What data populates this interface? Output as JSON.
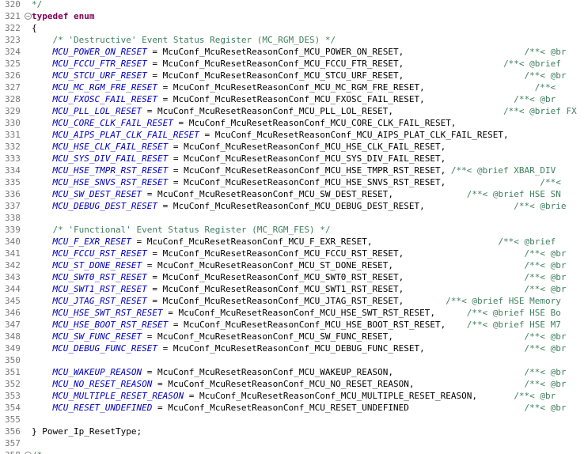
{
  "editor": {
    "lines": [
      {
        "n": "320",
        "fold": false,
        "segs": [
          {
            "c": "cm",
            "t": "*/"
          }
        ]
      },
      {
        "n": "321",
        "fold": true,
        "segs": [
          {
            "c": "kw",
            "t": "typedef enum"
          }
        ]
      },
      {
        "n": "322",
        "fold": false,
        "segs": [
          {
            "c": "tx",
            "t": "{"
          }
        ]
      },
      {
        "n": "323",
        "fold": false,
        "segs": [
          {
            "c": "tx",
            "t": "    "
          },
          {
            "c": "cm",
            "t": "/* 'Destructive' Event Status Register (MC_RGM_DES) */"
          }
        ]
      },
      {
        "n": "324",
        "fold": false,
        "segs": [
          {
            "c": "tx",
            "t": "    "
          },
          {
            "c": "en",
            "t": "MCU_POWER_ON_RESET"
          },
          {
            "c": "tx",
            "t": " = McuConf_McuResetReasonConf_MCU_POWER_ON_RESET,                       "
          },
          {
            "c": "cm",
            "t": "/**< @br"
          }
        ]
      },
      {
        "n": "325",
        "fold": false,
        "segs": [
          {
            "c": "tx",
            "t": "    "
          },
          {
            "c": "en",
            "t": "MCU_FCCU_FTR_RESET"
          },
          {
            "c": "tx",
            "t": " = McuConf_McuResetReasonConf_MCU_FCCU_FTR_RESET,                   "
          },
          {
            "c": "cm",
            "t": "/**< @brief"
          }
        ]
      },
      {
        "n": "326",
        "fold": false,
        "segs": [
          {
            "c": "tx",
            "t": "    "
          },
          {
            "c": "en",
            "t": "MCU_STCU_URF_RESET"
          },
          {
            "c": "tx",
            "t": " = McuConf_McuResetReasonConf_MCU_STCU_URF_RESET,                       "
          },
          {
            "c": "cm",
            "t": "/**< @br"
          }
        ]
      },
      {
        "n": "327",
        "fold": false,
        "segs": [
          {
            "c": "tx",
            "t": "    "
          },
          {
            "c": "en",
            "t": "MCU_MC_RGM_FRE_RESET"
          },
          {
            "c": "tx",
            "t": " = McuConf_McuResetReasonConf_MCU_MC_RGM_FRE_RESET,                     "
          },
          {
            "c": "cm",
            "t": "/**<"
          }
        ]
      },
      {
        "n": "328",
        "fold": false,
        "segs": [
          {
            "c": "tx",
            "t": "    "
          },
          {
            "c": "en",
            "t": "MCU_FXOSC_FAIL_RESET"
          },
          {
            "c": "tx",
            "t": " = McuConf_McuResetReasonConf_MCU_FXOSC_FAIL_RESET,                 "
          },
          {
            "c": "cm",
            "t": "/**< @br"
          }
        ]
      },
      {
        "n": "329",
        "fold": false,
        "segs": [
          {
            "c": "tx",
            "t": "    "
          },
          {
            "c": "en",
            "t": "MCU_PLL_LOL_RESET"
          },
          {
            "c": "tx",
            "t": " = McuConf_McuResetReasonConf_MCU_PLL_LOL_RESET,                     "
          },
          {
            "c": "cm",
            "t": "/**< @brief FX"
          }
        ]
      },
      {
        "n": "330",
        "fold": false,
        "segs": [
          {
            "c": "tx",
            "t": "    "
          },
          {
            "c": "en",
            "t": "MCU_CORE_CLK_FAIL_RESET"
          },
          {
            "c": "tx",
            "t": " = McuConf_McuResetReasonConf_MCU_CORE_CLK_FAIL_RESET,"
          }
        ]
      },
      {
        "n": "331",
        "fold": false,
        "segs": [
          {
            "c": "tx",
            "t": "    "
          },
          {
            "c": "en",
            "t": "MCU_AIPS_PLAT_CLK_FAIL_RESET"
          },
          {
            "c": "tx",
            "t": " = McuConf_McuResetReasonConf_MCU_AIPS_PLAT_CLK_FAIL_RESET,"
          }
        ]
      },
      {
        "n": "332",
        "fold": false,
        "segs": [
          {
            "c": "tx",
            "t": "    "
          },
          {
            "c": "en",
            "t": "MCU_HSE_CLK_FAIL_RESET"
          },
          {
            "c": "tx",
            "t": " = McuConf_McuResetReasonConf_MCU_HSE_CLK_FAIL_RESET,"
          }
        ]
      },
      {
        "n": "333",
        "fold": false,
        "segs": [
          {
            "c": "tx",
            "t": "    "
          },
          {
            "c": "en",
            "t": "MCU_SYS_DIV_FAIL_RESET"
          },
          {
            "c": "tx",
            "t": " = McuConf_McuResetReasonConf_MCU_SYS_DIV_FAIL_RESET,"
          }
        ]
      },
      {
        "n": "334",
        "fold": false,
        "segs": [
          {
            "c": "tx",
            "t": "    "
          },
          {
            "c": "en",
            "t": "MCU_HSE_TMPR_RST_RESET"
          },
          {
            "c": "tx",
            "t": " = McuConf_McuResetReasonConf_MCU_HSE_TMPR_RST_RESET, "
          },
          {
            "c": "cm",
            "t": "/**< @brief XBAR_DIV"
          }
        ]
      },
      {
        "n": "335",
        "fold": false,
        "segs": [
          {
            "c": "tx",
            "t": "    "
          },
          {
            "c": "en",
            "t": "MCU_HSE_SNVS_RST_RESET"
          },
          {
            "c": "tx",
            "t": " = McuConf_McuResetReasonConf_MCU_HSE_SNVS_RST_RESET,                  "
          },
          {
            "c": "cm",
            "t": "/**<"
          }
        ]
      },
      {
        "n": "336",
        "fold": false,
        "segs": [
          {
            "c": "tx",
            "t": "    "
          },
          {
            "c": "en",
            "t": "MCU_SW_DEST_RESET"
          },
          {
            "c": "tx",
            "t": " = McuConf_McuResetReasonConf_MCU_SW_DEST_RESET,              "
          },
          {
            "c": "cm",
            "t": "/**< @brief HSE SN"
          }
        ]
      },
      {
        "n": "337",
        "fold": false,
        "segs": [
          {
            "c": "tx",
            "t": "    "
          },
          {
            "c": "en",
            "t": "MCU_DEBUG_DEST_RESET"
          },
          {
            "c": "tx",
            "t": " = McuConf_McuResetReasonConf_MCU_DEBUG_DEST_RESET,                 "
          },
          {
            "c": "cm",
            "t": "/**< @brie"
          }
        ]
      },
      {
        "n": "338",
        "fold": false,
        "segs": []
      },
      {
        "n": "339",
        "fold": false,
        "segs": [
          {
            "c": "tx",
            "t": "    "
          },
          {
            "c": "cm",
            "t": "/* 'Functional' Event Status Register (MC_RGM_FES) */"
          }
        ]
      },
      {
        "n": "340",
        "fold": false,
        "segs": [
          {
            "c": "tx",
            "t": "    "
          },
          {
            "c": "en",
            "t": "MCU_F_EXR_RESET"
          },
          {
            "c": "tx",
            "t": " = McuConf_McuResetReasonConf_MCU_F_EXR_RESET,                        "
          },
          {
            "c": "cm",
            "t": "/**< @brief"
          }
        ]
      },
      {
        "n": "341",
        "fold": false,
        "segs": [
          {
            "c": "tx",
            "t": "    "
          },
          {
            "c": "en",
            "t": "MCU_FCCU_RST_RESET"
          },
          {
            "c": "tx",
            "t": " = McuConf_McuResetReasonConf_MCU_FCCU_RST_RESET,                       "
          },
          {
            "c": "cm",
            "t": "/**< @br"
          }
        ]
      },
      {
        "n": "342",
        "fold": false,
        "segs": [
          {
            "c": "tx",
            "t": "    "
          },
          {
            "c": "en",
            "t": "MCU_ST_DONE_RESET"
          },
          {
            "c": "tx",
            "t": " = McuConf_McuResetReasonConf_MCU_ST_DONE_RESET,                         "
          },
          {
            "c": "cm",
            "t": "/**< @br"
          }
        ]
      },
      {
        "n": "343",
        "fold": false,
        "segs": [
          {
            "c": "tx",
            "t": "    "
          },
          {
            "c": "en",
            "t": "MCU_SWT0_RST_RESET"
          },
          {
            "c": "tx",
            "t": " = McuConf_McuResetReasonConf_MCU_SWT0_RST_RESET,                       "
          },
          {
            "c": "cm",
            "t": "/**< @br"
          }
        ]
      },
      {
        "n": "344",
        "fold": false,
        "segs": [
          {
            "c": "tx",
            "t": "    "
          },
          {
            "c": "en",
            "t": "MCU_SWT1_RST_RESET"
          },
          {
            "c": "tx",
            "t": " = McuConf_McuResetReasonConf_MCU_SWT1_RST_RESET,                       "
          },
          {
            "c": "cm",
            "t": "/**< @br"
          }
        ]
      },
      {
        "n": "345",
        "fold": false,
        "segs": [
          {
            "c": "tx",
            "t": "    "
          },
          {
            "c": "en",
            "t": "MCU_JTAG_RST_RESET"
          },
          {
            "c": "tx",
            "t": " = McuConf_McuResetReasonConf_MCU_JTAG_RST_RESET,        "
          },
          {
            "c": "cm",
            "t": "/**< @brief HSE Memory"
          }
        ]
      },
      {
        "n": "346",
        "fold": false,
        "segs": [
          {
            "c": "tx",
            "t": "    "
          },
          {
            "c": "en",
            "t": "MCU_HSE_SWT_RST_RESET"
          },
          {
            "c": "tx",
            "t": " = McuConf_McuResetReasonConf_MCU_HSE_SWT_RST_RESET,      "
          },
          {
            "c": "cm",
            "t": "/**< @brief HSE Bo"
          }
        ]
      },
      {
        "n": "347",
        "fold": false,
        "segs": [
          {
            "c": "tx",
            "t": "    "
          },
          {
            "c": "en",
            "t": "MCU_HSE_BOOT_RST_RESET"
          },
          {
            "c": "tx",
            "t": " = McuConf_McuResetReasonConf_MCU_HSE_BOOT_RST_RESET,    "
          },
          {
            "c": "cm",
            "t": "/**< @brief HSE M7"
          }
        ]
      },
      {
        "n": "348",
        "fold": false,
        "segs": [
          {
            "c": "tx",
            "t": "    "
          },
          {
            "c": "en",
            "t": "MCU_SW_FUNC_RESET"
          },
          {
            "c": "tx",
            "t": " = McuConf_McuResetReasonConf_MCU_SW_FUNC_RESET,                         "
          },
          {
            "c": "cm",
            "t": "/**< @br"
          }
        ]
      },
      {
        "n": "349",
        "fold": false,
        "segs": [
          {
            "c": "tx",
            "t": "    "
          },
          {
            "c": "en",
            "t": "MCU_DEBUG_FUNC_RESET"
          },
          {
            "c": "tx",
            "t": " = McuConf_McuResetReasonConf_MCU_DEBUG_FUNC_RESET,                   "
          },
          {
            "c": "cm",
            "t": "/**< @br"
          }
        ]
      },
      {
        "n": "350",
        "fold": false,
        "segs": []
      },
      {
        "n": "351",
        "fold": false,
        "segs": [
          {
            "c": "tx",
            "t": "    "
          },
          {
            "c": "en",
            "t": "MCU_WAKEUP_REASON"
          },
          {
            "c": "tx",
            "t": " = McuConf_McuResetReasonConf_MCU_WAKEUP_REASON,                         "
          },
          {
            "c": "cm",
            "t": "/**< @br"
          }
        ]
      },
      {
        "n": "352",
        "fold": false,
        "segs": [
          {
            "c": "tx",
            "t": "    "
          },
          {
            "c": "en",
            "t": "MCU_NO_RESET_REASON"
          },
          {
            "c": "tx",
            "t": " = McuConf_McuResetReasonConf_MCU_NO_RESET_REASON,                     "
          },
          {
            "c": "cm",
            "t": "/**< @br"
          }
        ]
      },
      {
        "n": "353",
        "fold": false,
        "segs": [
          {
            "c": "tx",
            "t": "    "
          },
          {
            "c": "en",
            "t": "MCU_MULTIPLE_RESET_REASON"
          },
          {
            "c": "tx",
            "t": " = McuConf_McuResetReasonConf_MCU_MULTIPLE_RESET_REASON,       "
          },
          {
            "c": "cm",
            "t": "/**< @br"
          }
        ]
      },
      {
        "n": "354",
        "fold": false,
        "segs": [
          {
            "c": "tx",
            "t": "    "
          },
          {
            "c": "en",
            "t": "MCU_RESET_UNDEFINED"
          },
          {
            "c": "tx",
            "t": " = McuConf_McuResetReasonConf_MCU_RESET_UNDEFINED                      "
          },
          {
            "c": "cm",
            "t": "/**< @br"
          }
        ]
      },
      {
        "n": "355",
        "fold": false,
        "segs": []
      },
      {
        "n": "356",
        "fold": false,
        "segs": [
          {
            "c": "tx",
            "t": "} Power_Ip_ResetType;"
          }
        ]
      },
      {
        "n": "357",
        "fold": false,
        "segs": []
      },
      {
        "n": "358",
        "fold": true,
        "segs": [
          {
            "c": "cm",
            "t": "/*=========================================================================================="
          }
        ]
      }
    ]
  }
}
